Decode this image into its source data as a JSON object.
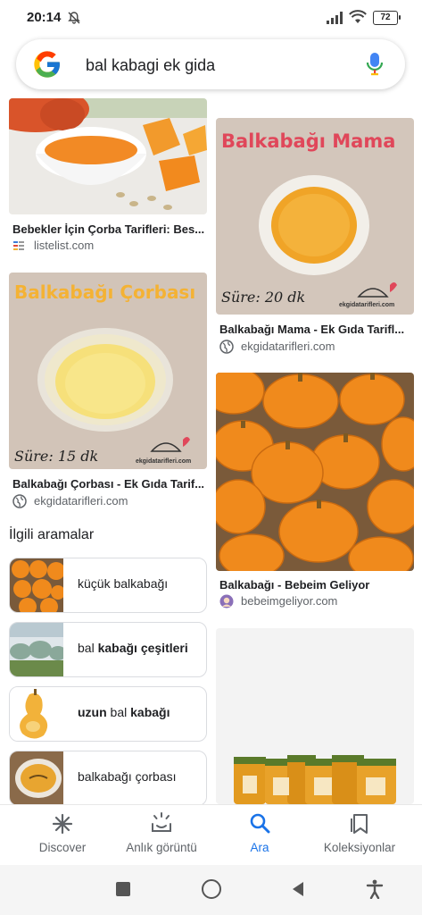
{
  "status_bar": {
    "time": "20:14",
    "battery": "72"
  },
  "search": {
    "query": "bal kabagi ek gida"
  },
  "results": [
    {
      "title": "Bebekler İçin Çorba Tarifleri: Bes...",
      "source": "listelist.com"
    },
    {
      "title": "Balkabağı Mama - Ek Gıda Tarifl...",
      "source": "ekgidatarifleri.com",
      "overlay_title": "Balkabağı Mama",
      "overlay_time": "Süre: 20 dk",
      "watermark": "ekgidatarifleri.com"
    },
    {
      "title": "Balkabağı Çorbası - Ek Gıda Tarif...",
      "source": "ekgidatarifleri.com",
      "overlay_title": "Balkabağı Çorbası",
      "overlay_time": "Süre: 15 dk",
      "watermark": "ekgidatarifleri.com"
    },
    {
      "title": "Balkabağı - Bebeim Geliyor",
      "source": "bebeimgeliyor.com"
    }
  ],
  "related": {
    "heading": "İlgili aramalar",
    "items": [
      {
        "plain1": "küçük balkabağı",
        "bold": "",
        "plain2": ""
      },
      {
        "plain1": "bal ",
        "bold": "kabağı çeşitleri",
        "plain2": ""
      },
      {
        "plain1": "",
        "bold": "uzun",
        "plain2": " bal ",
        "bold2": "kabağı"
      },
      {
        "plain1": "balkabağı çorbası",
        "bold": "",
        "plain2": ""
      }
    ]
  },
  "bottom_nav": [
    {
      "label": "Discover",
      "icon": "asterisk-icon",
      "active": false
    },
    {
      "label": "Anlık görüntü",
      "icon": "snapshot-icon",
      "active": false
    },
    {
      "label": "Ara",
      "icon": "search-icon",
      "active": true
    },
    {
      "label": "Koleksiyonlar",
      "icon": "collections-icon",
      "active": false
    }
  ],
  "colors": {
    "accent": "#1a73e8",
    "mama_title": "#e0475a",
    "corba_title": "#f4b234"
  }
}
